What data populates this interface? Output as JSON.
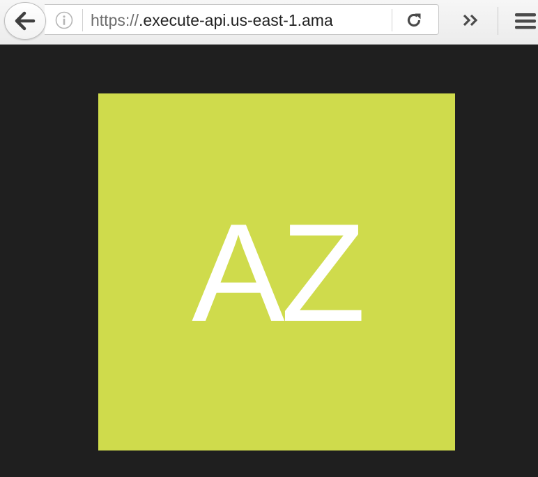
{
  "browser": {
    "url_scheme": "https://",
    "url_rest": ".execute-api.us-east-1.ama",
    "icons": {
      "back": "back-arrow-icon",
      "info": "info-icon",
      "reload": "reload-icon",
      "overflow": "double-chevron-right-icon",
      "menu": "hamburger-menu-icon"
    }
  },
  "page": {
    "avatar_initials": "AZ",
    "avatar_color": "#cfdb4c",
    "background_color": "#1f1f1f"
  }
}
